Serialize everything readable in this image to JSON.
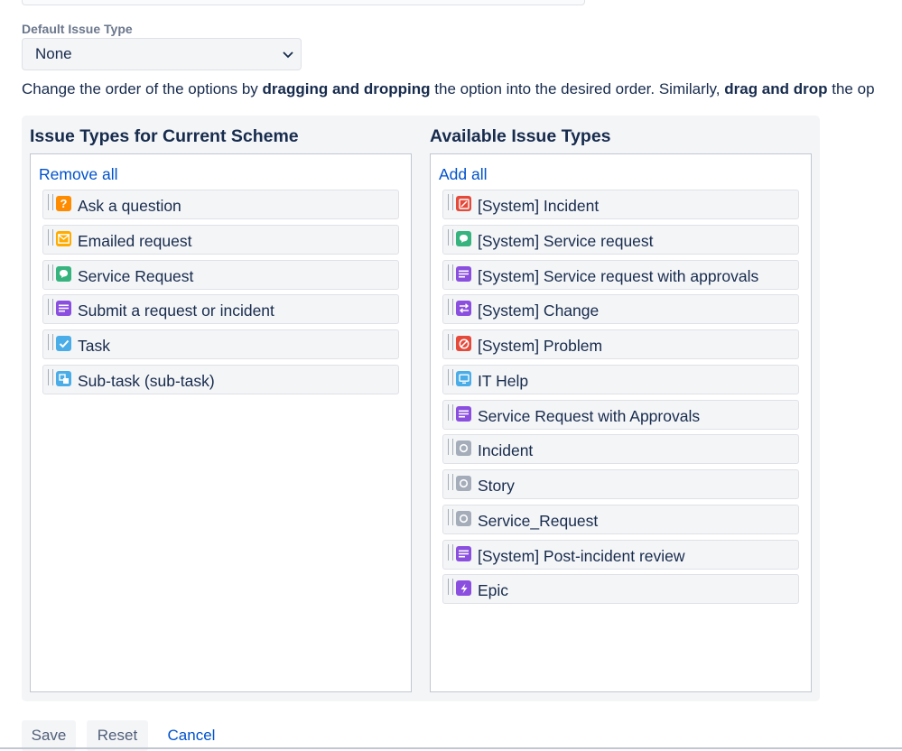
{
  "default_issue_type": {
    "label": "Default Issue Type",
    "value": "None"
  },
  "instruction": {
    "part1": "Change the order of the options by ",
    "bold1": "dragging and dropping",
    "part2": " the option into the desired order. Similarly, ",
    "bold2": "drag and drop",
    "part3": " the op"
  },
  "current_scheme": {
    "title": "Issue Types for Current Scheme",
    "action": "Remove all",
    "items": [
      {
        "label": "Ask a question",
        "icon": "question-icon",
        "color": "#ff8b00"
      },
      {
        "label": "Emailed request",
        "icon": "envelope-icon",
        "color": "#ffab00"
      },
      {
        "label": "Service Request",
        "icon": "chat-bubble-icon",
        "color": "#36b37e"
      },
      {
        "label": "Submit a request or incident",
        "icon": "lines-icon",
        "color": "#8b4fe0"
      },
      {
        "label": "Task",
        "icon": "checkmark-icon",
        "color": "#4bade8"
      },
      {
        "label": "Sub-task (sub-task)",
        "icon": "subtask-icon",
        "color": "#4bade8"
      }
    ]
  },
  "available": {
    "title": "Available Issue Types",
    "action": "Add all",
    "items": [
      {
        "label": "[System] Incident",
        "icon": "incident-icon",
        "color": "#e5493a"
      },
      {
        "label": "[System] Service request",
        "icon": "chat-bubble-icon",
        "color": "#36b37e"
      },
      {
        "label": "[System] Service request with approvals",
        "icon": "lines-icon",
        "color": "#8b4fe0"
      },
      {
        "label": "[System] Change",
        "icon": "arrows-icon",
        "color": "#8b4fe0"
      },
      {
        "label": "[System] Problem",
        "icon": "no-entry-icon",
        "color": "#e5493a"
      },
      {
        "label": "IT Help",
        "icon": "monitor-icon",
        "color": "#4bade8"
      },
      {
        "label": "Service Request with Approvals",
        "icon": "lines-icon",
        "color": "#8b4fe0"
      },
      {
        "label": "Incident",
        "icon": "circle-icon",
        "color": "#a5adba"
      },
      {
        "label": "Story",
        "icon": "circle-icon",
        "color": "#a5adba"
      },
      {
        "label": "Service_Request",
        "icon": "circle-icon",
        "color": "#a5adba"
      },
      {
        "label": "[System] Post-incident review",
        "icon": "lines-icon",
        "color": "#8b4fe0"
      },
      {
        "label": "Epic",
        "icon": "lightning-icon",
        "color": "#8b4fe0"
      }
    ]
  },
  "buttons": {
    "save": "Save",
    "reset": "Reset",
    "cancel": "Cancel"
  }
}
